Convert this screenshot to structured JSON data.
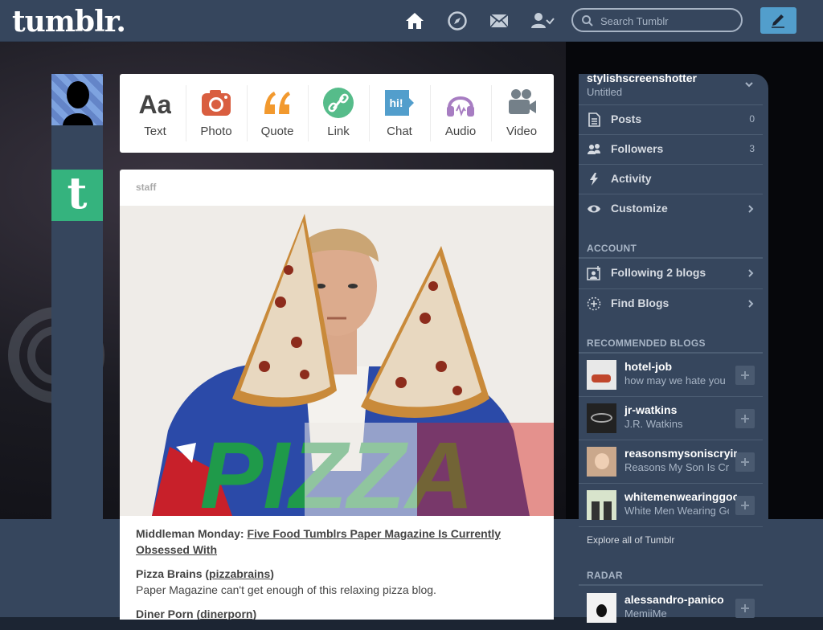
{
  "header": {
    "logo": "tumblr.",
    "search_placeholder": "Search Tumblr",
    "nav_icons": [
      "home-icon",
      "compass-icon",
      "mail-icon",
      "account-icon"
    ]
  },
  "post_types": [
    {
      "label": "Text",
      "color": "#444444"
    },
    {
      "label": "Photo",
      "color": "#d95e40"
    },
    {
      "label": "Quote",
      "color": "#f2992e"
    },
    {
      "label": "Link",
      "color": "#56bc8a"
    },
    {
      "label": "Chat",
      "color": "#529ecc"
    },
    {
      "label": "Audio",
      "color": "#a77dc2"
    },
    {
      "label": "Video",
      "color": "#748089"
    }
  ],
  "post": {
    "blog": "staff",
    "image_caption": "PIZZA",
    "intro": "Middleman Monday: ",
    "intro_link": "Five Food Tumblrs Paper Magazine Is Currently Obsessed With",
    "items": [
      {
        "title": "Pizza Brains (",
        "link": "pizzabrains",
        "title_end": ")",
        "desc": "Paper Magazine can't get enough of this relaxing pizza blog."
      },
      {
        "title": "Diner Porn (",
        "link": "dinerporn",
        "title_end": ")",
        "desc": ""
      }
    ]
  },
  "sidebar": {
    "account_name": "stylishscreenshotter",
    "account_subtitle": "Untitled",
    "menu": [
      {
        "label": "Posts",
        "count": "0",
        "icon": "posts-icon"
      },
      {
        "label": "Followers",
        "count": "3",
        "icon": "followers-icon"
      },
      {
        "label": "Activity",
        "count": "",
        "icon": "activity-icon"
      },
      {
        "label": "Customize",
        "count": "",
        "icon": "eye-icon"
      }
    ],
    "account_section": "ACCOUNT",
    "account_menu": [
      {
        "label": "Following 2 blogs",
        "icon": "following-icon"
      },
      {
        "label": "Find Blogs",
        "icon": "find-blogs-icon"
      }
    ],
    "recommended_section": "RECOMMENDED BLOGS",
    "recommended": [
      {
        "name": "hotel-job",
        "desc": "how may we hate you"
      },
      {
        "name": "jr-watkins",
        "desc": "J.R. Watkins"
      },
      {
        "name": "reasonsmysoniscrying",
        "desc": "Reasons My Son Is Crying"
      },
      {
        "name": "whitemenwearinggoogleglass",
        "desc": "White Men Wearing Google Glass"
      }
    ],
    "explore": "Explore all of Tumblr",
    "radar_section": "RADAR",
    "radar": {
      "name": "alessandro-panico",
      "desc": "MemiiMe"
    }
  }
}
